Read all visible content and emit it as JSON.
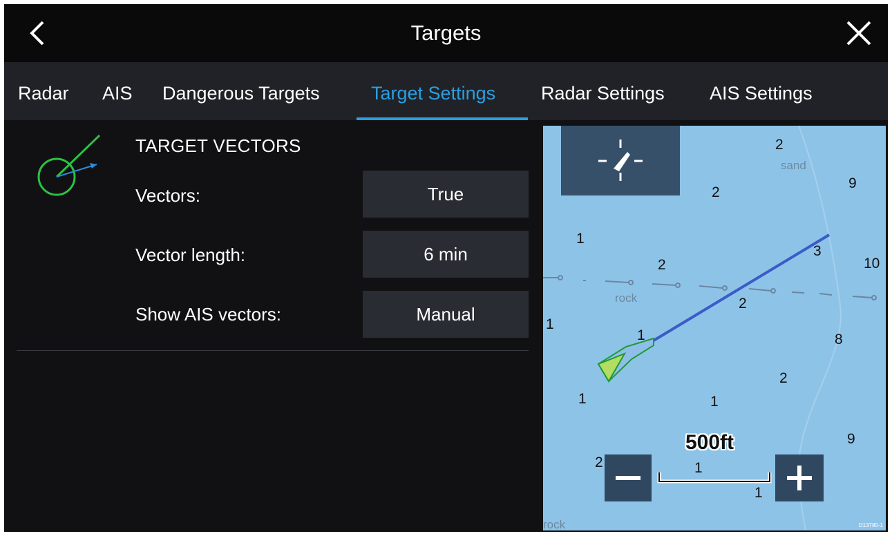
{
  "header": {
    "title": "Targets",
    "back_icon": "chevron-left-icon",
    "close_icon": "close-icon"
  },
  "tabs": [
    {
      "label": "Radar"
    },
    {
      "label": "AIS"
    },
    {
      "label": "Dangerous Targets"
    },
    {
      "label": "Target Settings",
      "active": true
    },
    {
      "label": "Radar Settings"
    },
    {
      "label": "AIS Settings"
    }
  ],
  "colors": {
    "accent": "#2a9fe0",
    "panel": "#2a2c33",
    "sea": "#8ec3e8",
    "vector": "#3a5cc8"
  },
  "settings": {
    "heading": "TARGET VECTORS",
    "icon": "target-vector-icon",
    "rows": [
      {
        "label": "Vectors:",
        "value": "True"
      },
      {
        "label": "Vector length:",
        "value": "6 min"
      },
      {
        "label": "Show AIS vectors:",
        "value": "Manual"
      }
    ]
  },
  "chart": {
    "scale_label": "500ft",
    "depths": [
      "2",
      "9",
      "2",
      "1",
      "3",
      "2",
      "10",
      "2",
      "1",
      "1",
      "8",
      "2",
      "1",
      "1",
      "9",
      "2",
      "1",
      "1"
    ],
    "seabed": [
      "sand",
      "rock",
      "rock"
    ],
    "doc_id": "D13780-1",
    "center_icon": "vessel-center-icon",
    "zoom_out_icon": "minus-icon",
    "zoom_in_icon": "plus-icon"
  }
}
